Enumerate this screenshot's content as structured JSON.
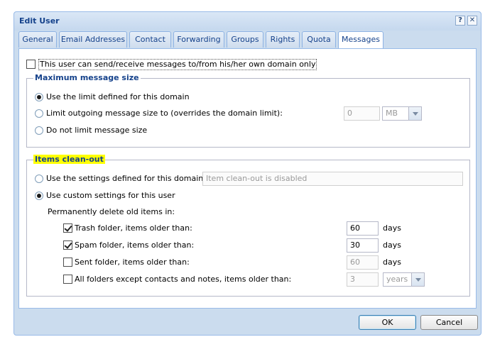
{
  "dialog": {
    "title": "Edit User",
    "help_glyph": "?",
    "close_glyph": "✕",
    "tabs": [
      {
        "label": "General"
      },
      {
        "label": "Email Addresses"
      },
      {
        "label": "Contact"
      },
      {
        "label": "Forwarding"
      },
      {
        "label": "Groups"
      },
      {
        "label": "Rights"
      },
      {
        "label": "Quota"
      },
      {
        "label": "Messages",
        "active": true
      }
    ],
    "own_domain_only": {
      "label": "This user can send/receive messages to/from his/her own domain only",
      "checked": false
    },
    "max_size": {
      "legend": "Maximum message size",
      "options": [
        {
          "label": "Use the limit defined for this domain",
          "selected": true
        },
        {
          "label": "Limit outgoing message size to (overrides the domain limit):",
          "selected": false
        },
        {
          "label": "Do not limit message size",
          "selected": false
        }
      ],
      "size_value": "0",
      "size_unit": "MB"
    },
    "cleanout": {
      "legend": "Items clean-out",
      "domain_option": {
        "label": "Use the settings defined for this domain:",
        "selected": false
      },
      "domain_status": "Item clean-out is disabled",
      "custom_option": {
        "label": "Use custom settings for this user",
        "selected": true
      },
      "delete_label": "Permanently delete old items in:",
      "trash": {
        "label": "Trash folder, items older than:",
        "checked": true,
        "value": "60",
        "unit": "days"
      },
      "spam": {
        "label": "Spam folder, items older than:",
        "checked": true,
        "value": "30",
        "unit": "days"
      },
      "sent": {
        "label": "Sent folder, items older than:",
        "checked": false,
        "value": "60",
        "unit": "days"
      },
      "all": {
        "label": "All folders except contacts and notes, items older than:",
        "checked": false,
        "value": "3",
        "unit": "years"
      }
    },
    "ok_label": "OK",
    "cancel_label": "Cancel"
  }
}
